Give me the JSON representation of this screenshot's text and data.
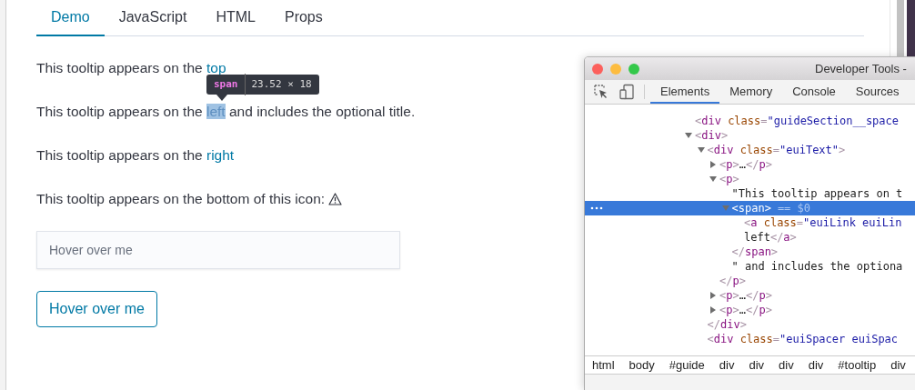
{
  "page": {
    "tabs": [
      {
        "label": "Demo",
        "selected": true
      },
      {
        "label": "JavaScript",
        "selected": false
      },
      {
        "label": "HTML",
        "selected": false
      },
      {
        "label": "Props",
        "selected": false
      }
    ],
    "paragraphs": [
      {
        "text": "This tooltip appears on the ",
        "link": "top",
        "link_highlighted": false
      },
      {
        "text": "This tooltip appears on the ",
        "link": "left",
        "link_highlighted": true,
        "after": " and includes the optional title."
      },
      {
        "text": "This tooltip appears on the ",
        "link": "right",
        "link_highlighted": false
      },
      {
        "text": "This tooltip appears on the bottom of this icon:",
        "kind": "icon"
      }
    ],
    "inspector_tooltip": {
      "tag": "span",
      "size": "23.52 × 18"
    },
    "card": {
      "text": "Hover over me"
    },
    "button": {
      "label": "Hover over me"
    }
  },
  "devtools": {
    "window": {
      "title": "Developer Tools -"
    },
    "tabs": [
      {
        "label": "Elements",
        "selected": true
      },
      {
        "label": "Memory",
        "selected": false
      },
      {
        "label": "Console",
        "selected": false
      },
      {
        "label": "Sources",
        "selected": false
      }
    ],
    "tree": [
      {
        "kind": "element",
        "lines": [
          "<div class=\"guideSection__space"
        ],
        "selected": false
      },
      {
        "kind": "element",
        "lines": [
          "<div>"
        ],
        "expanded": true,
        "selected": false,
        "children": [
          {
            "kind": "element",
            "lines": [
              "<div class=\"euiText\">"
            ],
            "expanded": true,
            "selected": false,
            "closing": "</div>",
            "children": [
              {
                "kind": "element",
                "lines": [
                  "<p>…</p>"
                ],
                "expanded": false,
                "selected": false
              },
              {
                "kind": "element",
                "lines": [
                  "<p>"
                ],
                "expanded": true,
                "selected": false,
                "closing": "</p>",
                "children": [
                  {
                    "kind": "text",
                    "lines": [
                      "\"This tooltip appears on t"
                    ],
                    "selected": false
                  },
                  {
                    "kind": "element",
                    "lines": [
                      "<span>"
                    ],
                    "expanded": true,
                    "selected": true,
                    "ref": "== $0",
                    "closing": "</span>",
                    "children": [
                      {
                        "kind": "element",
                        "lines": [
                          "<a class=\"euiLink euiLin",
                          "left</a>"
                        ],
                        "selected": false
                      }
                    ]
                  },
                  {
                    "kind": "text",
                    "lines": [
                      "\" and includes the optiona"
                    ],
                    "selected": false
                  }
                ]
              },
              {
                "kind": "element",
                "lines": [
                  "<p>…</p>"
                ],
                "expanded": false,
                "selected": false
              },
              {
                "kind": "element",
                "lines": [
                  "<p>…</p>"
                ],
                "expanded": false,
                "selected": false
              }
            ]
          },
          {
            "kind": "element",
            "lines": [
              "<div class=\"euiSpacer euiSpac"
            ],
            "selected": false
          }
        ]
      }
    ],
    "breadcrumbs": [
      "html",
      "body",
      "#guide",
      "div",
      "div",
      "div",
      "div",
      "#tooltip",
      "div"
    ]
  }
}
